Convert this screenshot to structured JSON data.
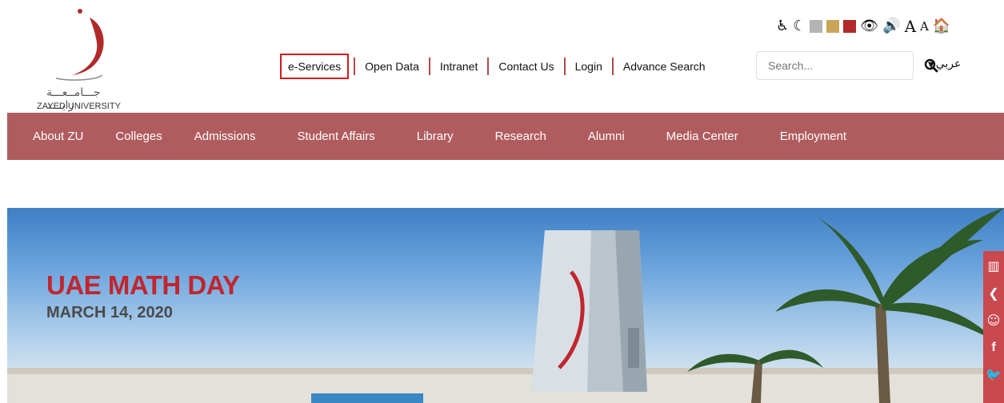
{
  "logo": {
    "arabic_name": "جـــامــعـــة زايـــد",
    "english_name": "ZAYED UNIVERSITY"
  },
  "accessibility_tools": [
    {
      "icon": "wheelchair-icon",
      "glyph": "♿"
    },
    {
      "icon": "moon-icon",
      "glyph": "☾"
    },
    {
      "icon": "eye-icon",
      "glyph": "👁"
    },
    {
      "icon": "speaker-icon",
      "glyph": "🔊"
    },
    {
      "icon": "font-increase-icon",
      "glyph": "A"
    },
    {
      "icon": "font-decrease-icon",
      "glyph": "A"
    },
    {
      "icon": "home-icon",
      "glyph": "🏠"
    }
  ],
  "theme_colors": [
    "#b3b3b3",
    "#c9a55a",
    "#b02a2a"
  ],
  "top_links": [
    "e-Services",
    "Open Data",
    "Intranet",
    "Contact Us",
    "Login",
    "Advance Search"
  ],
  "search": {
    "placeholder": "Search..."
  },
  "language": {
    "label": "عربي"
  },
  "nav": [
    "About ZU",
    "Colleges",
    "Admissions",
    "Student Affairs",
    "Library",
    "Research",
    "Alumni",
    "Media Center",
    "Employment"
  ],
  "hero": {
    "title": "UAE MATH DAY",
    "date": "MARCH 14, 2020"
  },
  "social": [
    "chart-icon",
    "chevron-left-icon",
    "smiley-icon",
    "facebook-icon",
    "twitter-icon"
  ],
  "colors": {
    "accent": "#b05c5f",
    "hero_red": "#c0262e",
    "highlight_border": "#d01c1c"
  }
}
